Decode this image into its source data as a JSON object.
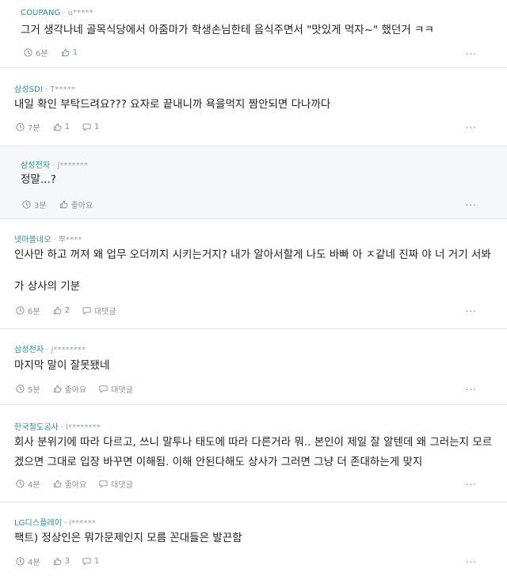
{
  "comments": [
    {
      "company": "COUPANG",
      "user": "u*****",
      "lines": [
        "그거 생각나네 골목식당에서 아줌마가 학생손님한테 음식주면서 \"맛있게 먹자~\" 했던거 ㅋㅋ"
      ],
      "time": "6분",
      "likes": "1",
      "replies": "",
      "reply_label": "",
      "more": "..."
    },
    {
      "company": "삼성SDI",
      "user": "T*****",
      "lines": [
        "내일 확인 부탁드려요??? 요자로 끝내니까 욕을먹지 짬안되면 다나까다"
      ],
      "time": "7분",
      "likes": "1",
      "replies": "1",
      "reply_label": "",
      "more": "..."
    },
    {
      "company": "삼성전자",
      "user": "j*******",
      "lines": [
        "정말...?"
      ],
      "time": "3분",
      "likes": "좋아요",
      "replies": "",
      "reply_label": "",
      "more": "..."
    },
    {
      "company": "넷마블네오",
      "user": "뿌****",
      "lines": [
        "인사만 하고 꺼져 왜 업무 오더끼지 시키는거지? 내가 알아서할게 나도 바빠 아 ㅈ같네 진짜 야 너 거기 서봐",
        "",
        "가 상사의 기분"
      ],
      "time": "6분",
      "likes": "2",
      "replies": "",
      "reply_label": "대댓글",
      "more": "..."
    },
    {
      "company": "삼성전자",
      "user": "j********",
      "lines": [
        "마지막 말이 잘못됐네"
      ],
      "time": "5분",
      "likes": "좋아요",
      "replies": "",
      "reply_label": "대댓글",
      "more": "..."
    },
    {
      "company": "한국철도공사",
      "user": "l********",
      "lines": [
        "회사 분위기에 따라 다르고, 쓰니 말투나 태도에 따라 다른거라 뭐.. 본인이 제일 잘 알텐데 왜 그러는지 모르",
        "겠으면 그대로 입장 바꾸면 이해됨. 이해 안된다해도 상사가 그러면 그냥 더 존대하는게 맞지"
      ],
      "time": "4분",
      "likes": "좋아요",
      "replies": "",
      "reply_label": "대댓글",
      "more": "..."
    },
    {
      "company": "LG디스플레이",
      "user": "l******",
      "lines": [
        "팩트) 정상인은 뭐가문제인지 모름 꼰대들은 발끈함"
      ],
      "time": "4분",
      "likes": "3",
      "replies": "1",
      "reply_label": "",
      "more": "..."
    }
  ],
  "icons": {
    "time": "clock-icon",
    "like": "thumbs-up-icon",
    "reply": "speech-bubble-icon"
  },
  "colors": {
    "company": "#2a8f8f",
    "muted": "#8a8f96",
    "reply_bg": "#f6f7f9",
    "divider": "#e6e6e6"
  }
}
